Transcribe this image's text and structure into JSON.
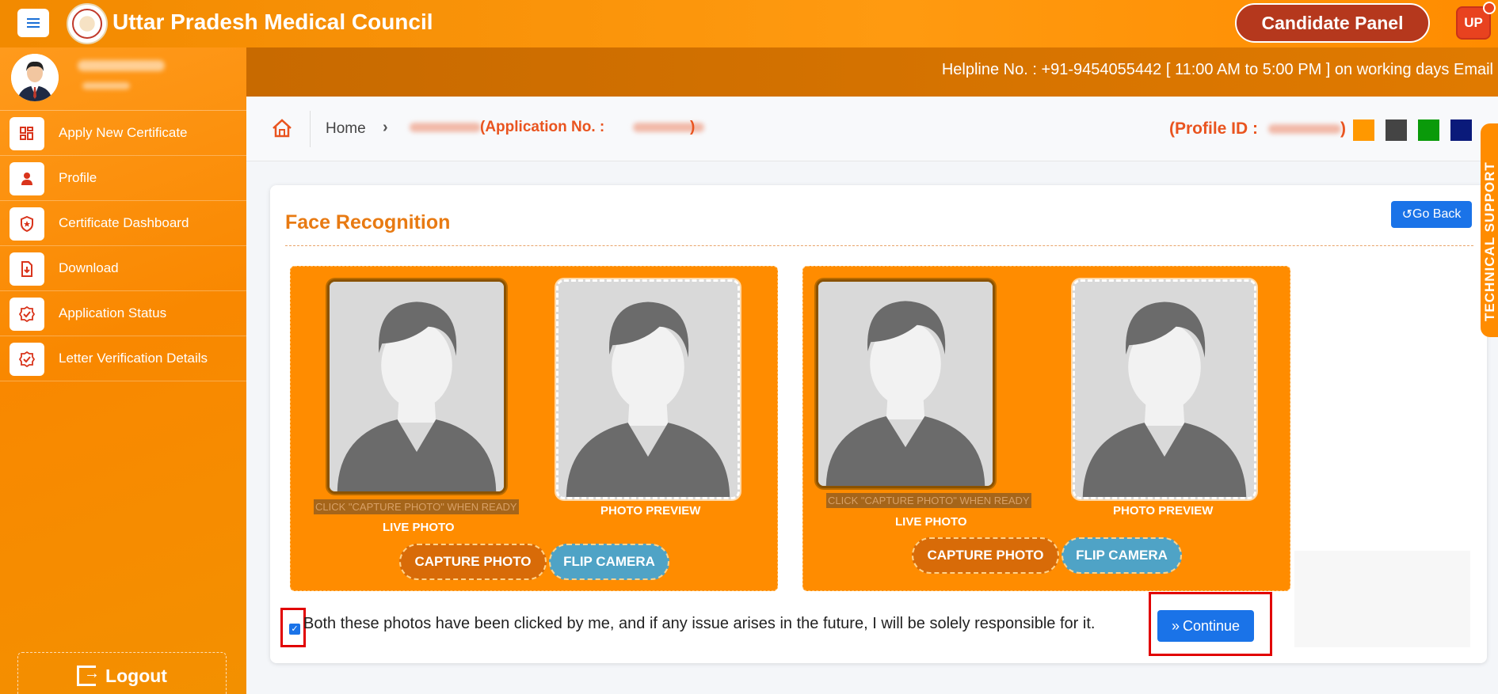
{
  "header": {
    "title": "Uttar Pradesh Medical Council",
    "panel_button": "Candidate Panel",
    "user_badge": "UP"
  },
  "sidebar": {
    "items": [
      {
        "label": "Apply New Certificate",
        "icon": "grid-icon"
      },
      {
        "label": "Profile",
        "icon": "user-icon"
      },
      {
        "label": "Certificate Dashboard",
        "icon": "shield-star-icon"
      },
      {
        "label": "Download",
        "icon": "download-file-icon"
      },
      {
        "label": "Application Status",
        "icon": "badge-check-icon"
      },
      {
        "label": "Letter Verification Details",
        "icon": "badge-check-icon"
      }
    ],
    "logout": "Logout"
  },
  "helpline": "Helpline No. : +91-9454055442 [ 11:00 AM to 5:00 PM ] on working days   Email",
  "breadcrumb": {
    "home": "Home",
    "application": "(Application No. :",
    "application_close": ")",
    "profile_id": "(Profile ID :",
    "profile_close": ")"
  },
  "theme_colors": [
    "#ff9800",
    "#444444",
    "#0a9a0a",
    "#0a1a7a"
  ],
  "card": {
    "title": "Face Recognition",
    "go_back": "Go Back",
    "panels": [
      {
        "hint": "CLICK \"CAPTURE PHOTO\" WHEN READY",
        "live_label": "LIVE PHOTO",
        "preview_label": "PHOTO PREVIEW",
        "capture": "CAPTURE PHOTO",
        "flip": "FLIP CAMERA"
      },
      {
        "hint": "CLICK \"CAPTURE PHOTO\" WHEN READY",
        "live_label": "LIVE PHOTO",
        "preview_label": "PHOTO PREVIEW",
        "capture": "CAPTURE PHOTO",
        "flip": "FLIP CAMERA"
      }
    ],
    "consent": "Both these photos have been clicked by me, and if any issue arises in the future, I will be solely responsible for it.",
    "consent_checked": true,
    "continue": "Continue"
  },
  "technical_support": "TECHNICAL SUPPORT"
}
